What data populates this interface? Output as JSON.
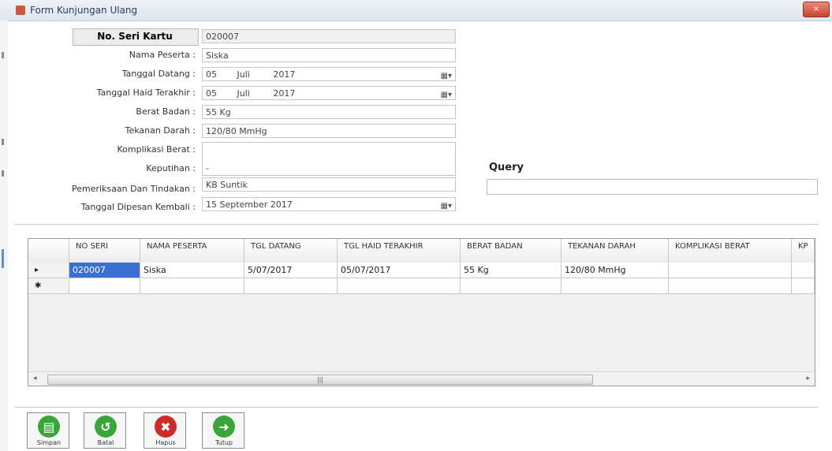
{
  "window": {
    "title": "Form Kunjungan Ulang",
    "close_label": "×"
  },
  "form": {
    "no_seri_label": "No. Seri Kartu",
    "no_seri_value": "020007",
    "nama_label": "Nama Peserta :",
    "nama_value": "Siska",
    "tgl_datang_label": "Tanggal Datang :",
    "tgl_datang_day": "05",
    "tgl_datang_month": "Juli",
    "tgl_datang_year": "2017",
    "tgl_haid_label": "Tanggal Haid Terakhir :",
    "tgl_haid_day": "05",
    "tgl_haid_month": "Juli",
    "tgl_haid_year": "2017",
    "berat_label": "Berat Badan :",
    "berat_value": "55 Kg",
    "tekanan_label": "Tekanan Darah :",
    "tekanan_value": "120/80 MmHg",
    "komplikasi_label": "Komplikasi Berat :",
    "komplikasi_value": "",
    "keputihan_label": "Keputihan :",
    "keputihan_value": "-",
    "pemeriksaan_label": "Pemeriksaan Dan Tindakan :",
    "pemeriksaan_value": "KB Suntik",
    "tgl_kembali_label": "Tanggal Dipesan Kembali :",
    "tgl_kembali_value": "15 September 2017",
    "calendar_icon": "calendar-dropdown-icon",
    "calendar_glyph": "▦▾"
  },
  "query": {
    "label": "Query",
    "value": ""
  },
  "grid": {
    "columns": [
      "NO SERI",
      "NAMA PESERTA",
      "TGL DATANG",
      "TGL HAID TERAKHIR",
      "BERAT BADAN",
      "TEKANAN DARAH",
      "KOMPLIKASI BERAT",
      "KP"
    ],
    "rows": [
      {
        "marker": "▸",
        "cells": [
          "020007",
          "Siska",
          "5/07/2017",
          "05/07/2017",
          "55 Kg",
          "120/80 MmHg",
          ""
        ]
      },
      {
        "marker": "✱",
        "cells": [
          "",
          "",
          "",
          "",
          "",
          "",
          ""
        ]
      }
    ],
    "scroll_thumb": "|||",
    "scroll_left": "◂",
    "scroll_right": "▸"
  },
  "toolbar": {
    "buttons": [
      {
        "label": "Simpan",
        "glyph": "▤",
        "color": "#3aa63a"
      },
      {
        "label": "Batal",
        "glyph": "↺",
        "color": "#3aa63a"
      },
      {
        "label": "Hapus",
        "glyph": "✖",
        "color": "#cf2a2a"
      },
      {
        "label": "Tutup",
        "glyph": "➜",
        "color": "#3aa63a"
      }
    ]
  }
}
